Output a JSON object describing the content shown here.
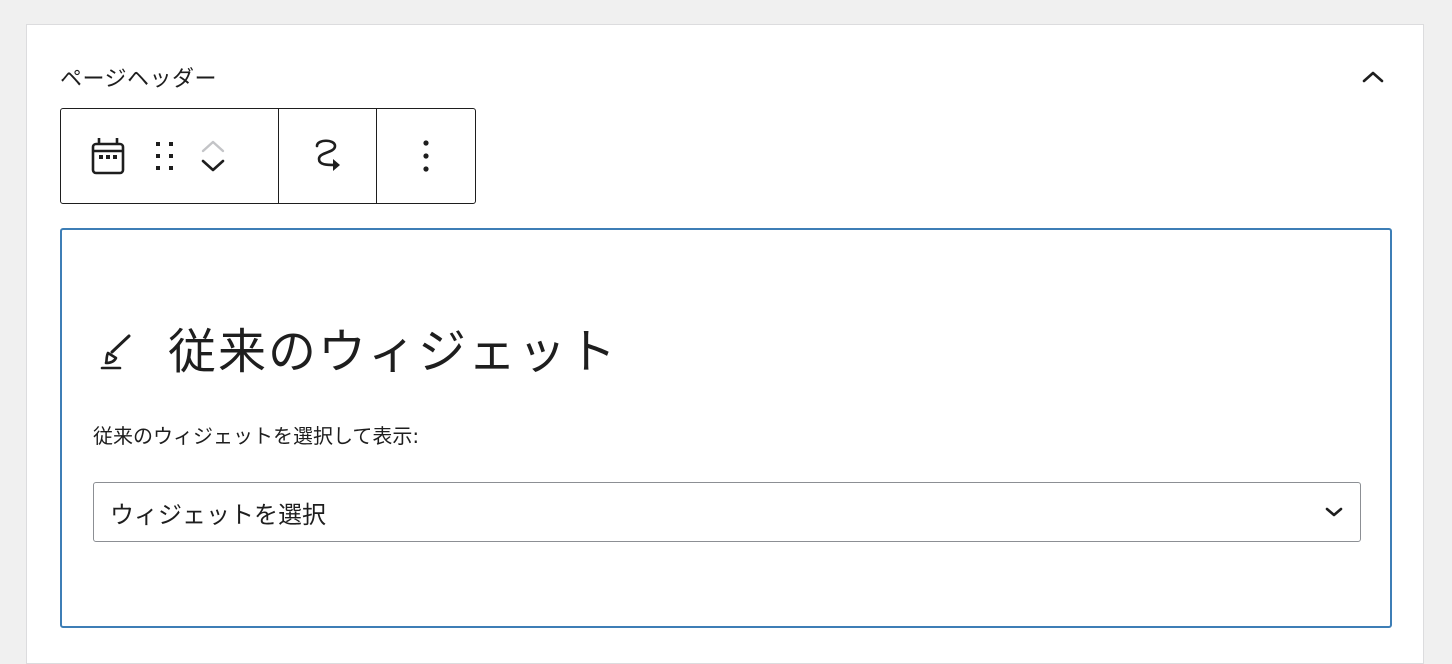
{
  "widget_area": {
    "title": "ページヘッダー",
    "collapse_icon": "chevron-up-icon"
  },
  "toolbar": {
    "block_type_icon": "calendar-icon",
    "drag_icon": "drag-handle-icon",
    "move_up_icon": "chevron-up-icon",
    "move_down_icon": "chevron-down-icon",
    "transform_icon": "transform-arrow-icon",
    "options_icon": "more-vertical-icon"
  },
  "block": {
    "title_icon": "brush-icon",
    "title": "従来のウィジェット",
    "description": "従来のウィジェットを選択して表示:",
    "select": {
      "value": "ウィジェットを選択",
      "icon": "chevron-down-icon"
    },
    "border_color": "#3d7eb6"
  }
}
